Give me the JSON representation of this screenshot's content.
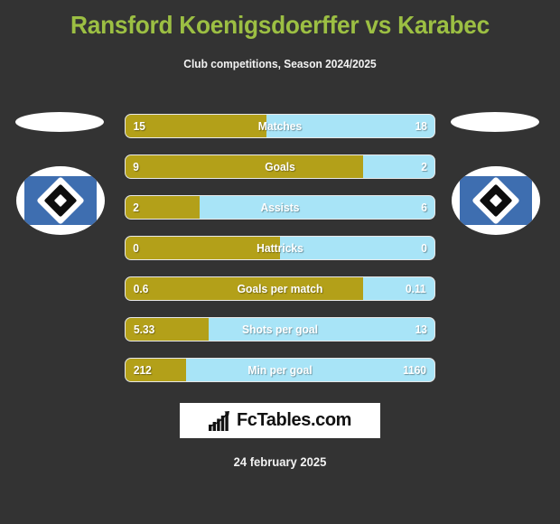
{
  "header": {
    "title": "Ransford Koenigsdoerffer vs Karabec",
    "subtitle": "Club competitions, Season 2024/2025"
  },
  "colors": {
    "background": "#333333",
    "title_green": "#9cbf43",
    "home_gold": "#b3a019",
    "away_blue": "#a8e4f7",
    "crest_blue": "#3e6eb0",
    "text_white": "#ffffff"
  },
  "crests": {
    "left": {
      "name": "hsv-crest-left"
    },
    "right": {
      "name": "hsv-crest-right"
    }
  },
  "chart_data": {
    "type": "bar",
    "title": "Ransford Koenigsdoerffer vs Karabec",
    "subtitle": "Club competitions, Season 2024/2025",
    "orientation": "horizontal-diverging",
    "categories": [
      "Matches",
      "Goals",
      "Assists",
      "Hattricks",
      "Goals per match",
      "Shots per goal",
      "Min per goal"
    ],
    "series": [
      {
        "name": "Ransford Koenigsdoerffer",
        "color": "#b3a019",
        "values": [
          15,
          9,
          2,
          0,
          0.6,
          5.33,
          212
        ]
      },
      {
        "name": "Karabec",
        "color": "#a8e4f7",
        "values": [
          18,
          2,
          6,
          0,
          0.11,
          13,
          1160
        ]
      }
    ],
    "rows": [
      {
        "label": "Matches",
        "home": "15",
        "away": "18",
        "home_pct": 45.5
      },
      {
        "label": "Goals",
        "home": "9",
        "away": "2",
        "home_pct": 77.0
      },
      {
        "label": "Assists",
        "home": "2",
        "away": "6",
        "home_pct": 24.0
      },
      {
        "label": "Hattricks",
        "home": "0",
        "away": "0",
        "home_pct": 50.0
      },
      {
        "label": "Goals per match",
        "home": "0.6",
        "away": "0.11",
        "home_pct": 77.0
      },
      {
        "label": "Shots per goal",
        "home": "5.33",
        "away": "13",
        "home_pct": 27.0
      },
      {
        "label": "Min per goal",
        "home": "212",
        "away": "1160",
        "home_pct": 19.5
      }
    ],
    "grid": false,
    "legend": "none"
  },
  "footer": {
    "logo_text": "FcTables.com",
    "logo_icon": "bar-chart-growth-icon",
    "date": "24 february 2025"
  }
}
